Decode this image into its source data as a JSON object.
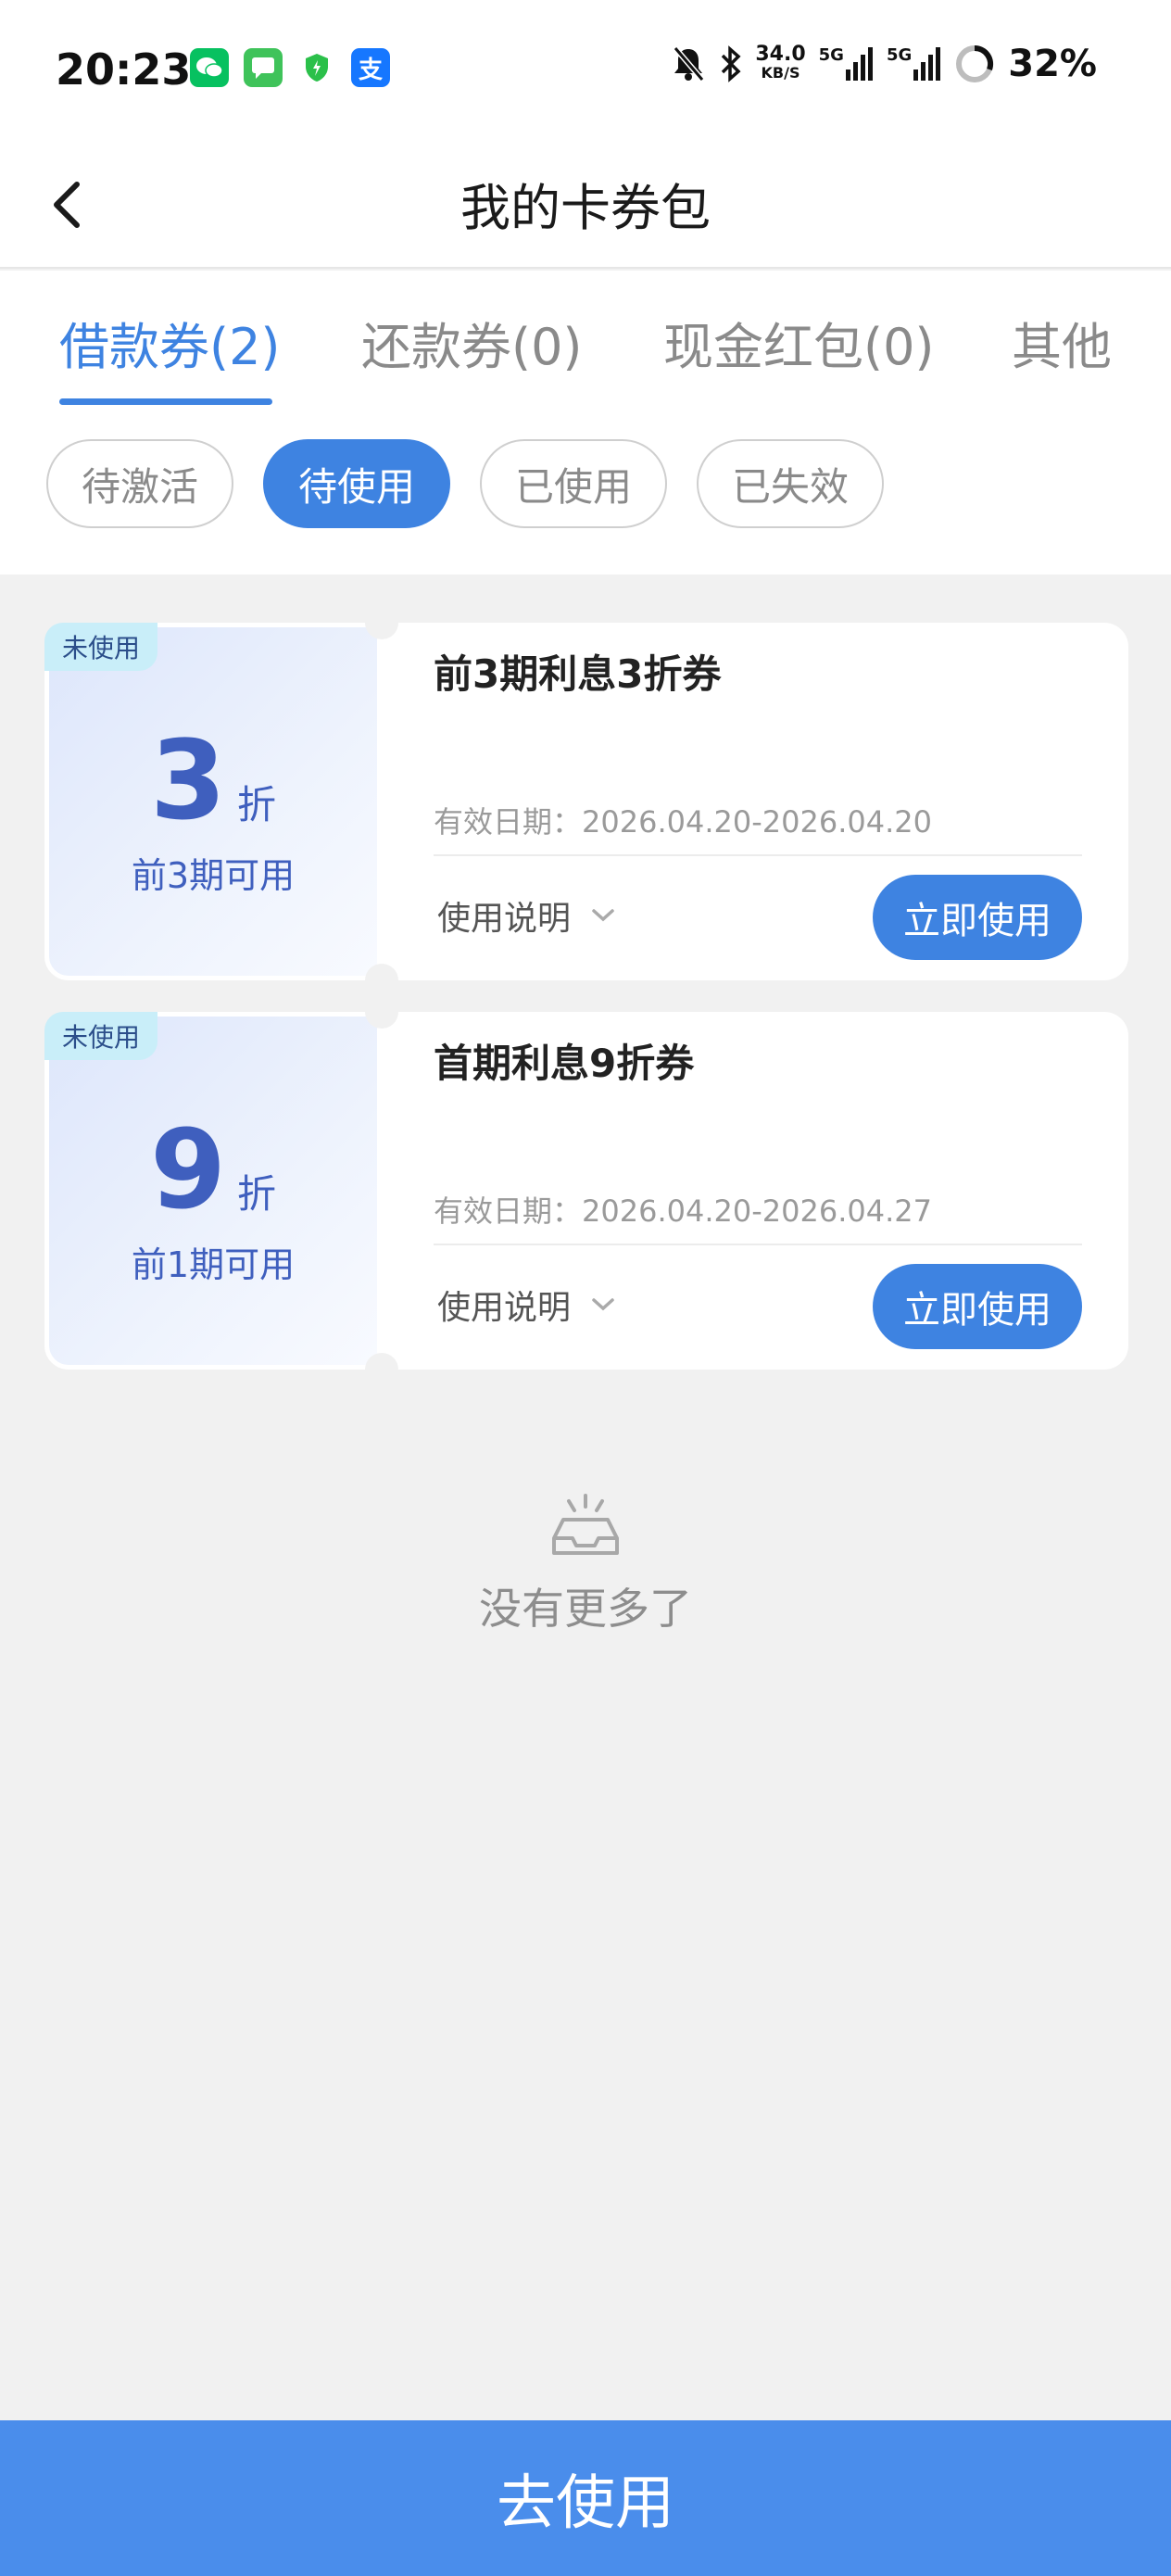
{
  "status_bar": {
    "time": "20:23",
    "apps": [
      {
        "icon": "wechat-icon",
        "color": "#07c160"
      },
      {
        "icon": "messages-icon",
        "color": "#3fc35a"
      },
      {
        "icon": "shield-icon",
        "color": "#2bc04a"
      },
      {
        "icon": "alipay-icon",
        "color": "#1677ff",
        "glyph": "支"
      }
    ],
    "speed": "34.0",
    "speed_unit": "KB/S",
    "network_1": "5G",
    "network_2": "5G",
    "battery": "32%"
  },
  "header": {
    "title": "我的卡券包",
    "back_icon": "chevron-left-icon"
  },
  "tabs": [
    {
      "label": "借款券(2)",
      "active": true
    },
    {
      "label": "还款券(0)",
      "active": false
    },
    {
      "label": "现金红包(0)",
      "active": false
    },
    {
      "label": "其他",
      "active": false
    }
  ],
  "filters": [
    {
      "label": "待激活",
      "active": false
    },
    {
      "label": "待使用",
      "active": true
    },
    {
      "label": "已使用",
      "active": false
    },
    {
      "label": "已失效",
      "active": false
    }
  ],
  "coupons": [
    {
      "badge": "未使用",
      "discount": "3",
      "unit": "折",
      "sub": "前3期可用",
      "name": "前3期利息3折券",
      "date": "有效日期：2026.04.20-2026.04.20",
      "help": "使用说明",
      "button": "立即使用"
    },
    {
      "badge": "未使用",
      "discount": "9",
      "unit": "折",
      "sub": "前1期可用",
      "name": "首期利息9折券",
      "date": "有效日期：2026.04.20-2026.04.27",
      "help": "使用说明",
      "button": "立即使用"
    }
  ],
  "empty": {
    "icon": "empty-tray-icon",
    "text": "没有更多了"
  },
  "bottom_button": "去使用",
  "colors": {
    "accent": "#3e83e1",
    "bottom_bar": "#4a8deb",
    "discount_text": "#3f5fbe",
    "badge_bg": "#c9eef9"
  }
}
